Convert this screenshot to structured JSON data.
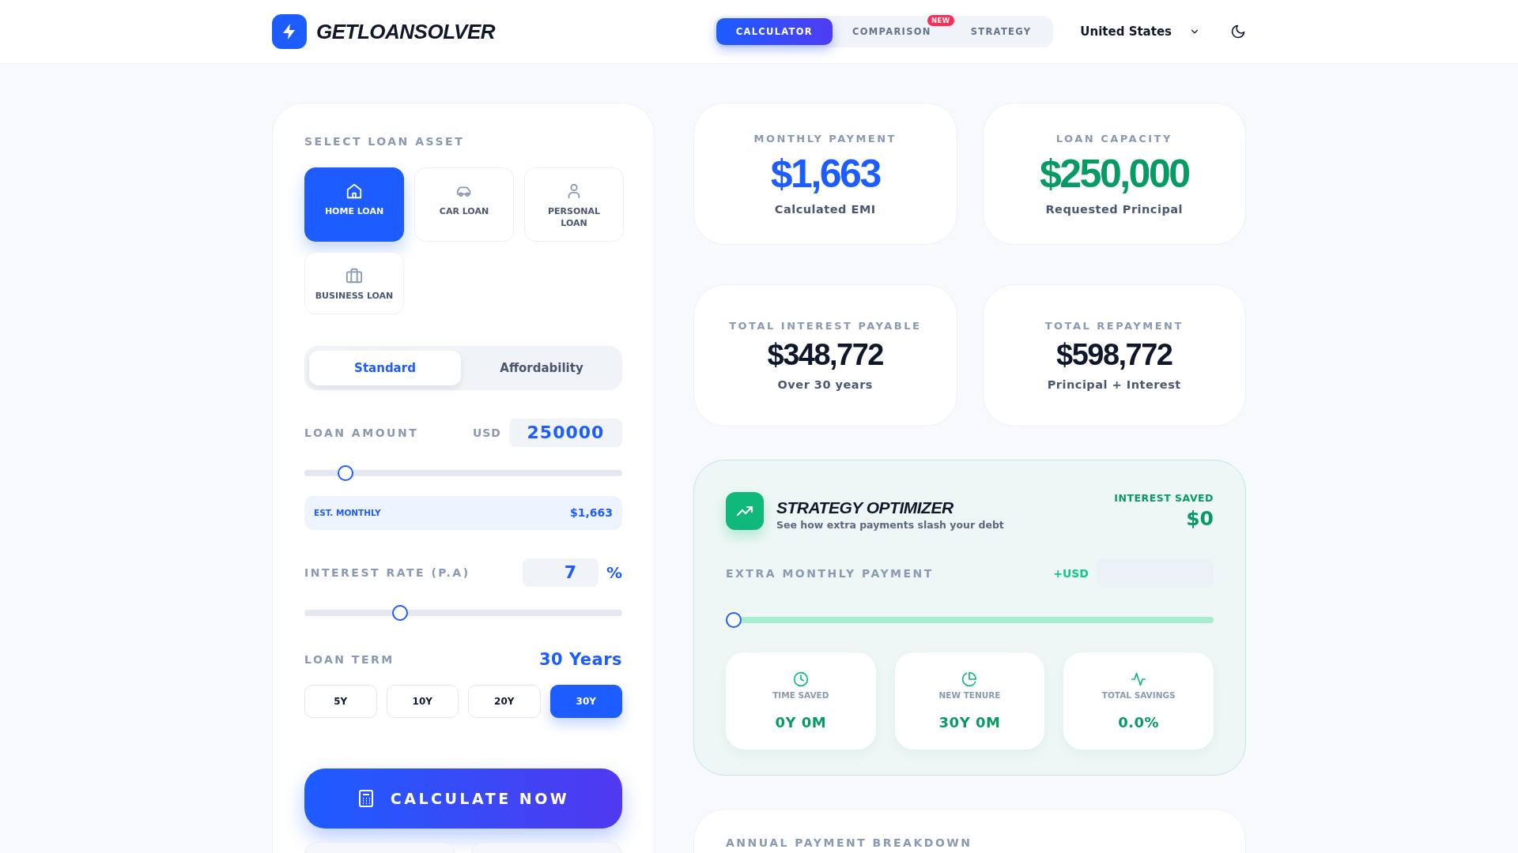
{
  "brand": {
    "name": "GETLOANSOLVER"
  },
  "nav": {
    "tabs": [
      {
        "label": "CALCULATOR",
        "selected": true
      },
      {
        "label": "COMPARISON",
        "selected": false,
        "badge": "NEW"
      },
      {
        "label": "STRATEGY",
        "selected": false
      }
    ],
    "country": "United States"
  },
  "loan_form": {
    "asset_heading": "SELECT LOAN ASSET",
    "assets": [
      {
        "kind": "home",
        "label": "HOME LOAN",
        "selected": true
      },
      {
        "kind": "car",
        "label": "CAR LOAN",
        "selected": false
      },
      {
        "kind": "person",
        "label": "PERSONAL LOAN",
        "selected": false
      },
      {
        "kind": "briefcase",
        "label": "BUSINESS LOAN",
        "selected": false
      }
    ],
    "modes": [
      {
        "label": "Standard",
        "selected": true
      },
      {
        "label": "Affordability",
        "selected": false
      }
    ],
    "amount": {
      "label": "LOAN AMOUNT",
      "currency": "USD",
      "value": "250000",
      "level": 0.11
    },
    "est_monthly": {
      "label": "EST. MONTHLY",
      "value": "$1,663"
    },
    "rate": {
      "label": "INTEREST RATE (P.A)",
      "value": "7",
      "unit": "%",
      "level": 0.29
    },
    "term": {
      "label": "LOAN TERM",
      "value": "30 Years",
      "options": [
        {
          "label": "5Y",
          "selected": false
        },
        {
          "label": "10Y",
          "selected": false
        },
        {
          "label": "20Y",
          "selected": false
        },
        {
          "label": "30Y",
          "selected": true
        }
      ]
    },
    "calculate_button": "CALCULATE NOW"
  },
  "stats": [
    {
      "label": "MONTHLY PAYMENT",
      "value": "$1,663",
      "caption": "Calculated EMI",
      "color": "#1d5cff"
    },
    {
      "label": "LOAN CAPACITY",
      "value": "$250,000",
      "caption": "Requested Principal",
      "color": "#079a63"
    },
    {
      "label": "TOTAL INTEREST PAYABLE",
      "value": "$348,772",
      "caption": "Over 30 years",
      "color": "#0f172a"
    },
    {
      "label": "TOTAL REPAYMENT",
      "value": "$598,772",
      "caption": "Principal + Interest",
      "color": "#0f172a"
    }
  ],
  "strategy": {
    "title": "STRATEGY OPTIMIZER",
    "subtitle": "See how extra payments slash your debt",
    "saved_label": "INTEREST SAVED",
    "saved_value": "$0",
    "extra": {
      "label": "EXTRA MONTHLY PAYMENT",
      "currency": "+USD",
      "level": 0
    },
    "metrics": [
      {
        "kind": "clock",
        "label": "TIME SAVED",
        "value": "0Y 0M"
      },
      {
        "kind": "pie",
        "label": "NEW TENURE",
        "value": "30Y 0M"
      },
      {
        "kind": "pulse",
        "label": "TOTAL SAVINGS",
        "value": "0.0%"
      }
    ]
  },
  "breakdown": {
    "title": "ANNUAL PAYMENT BREAKDOWN"
  }
}
